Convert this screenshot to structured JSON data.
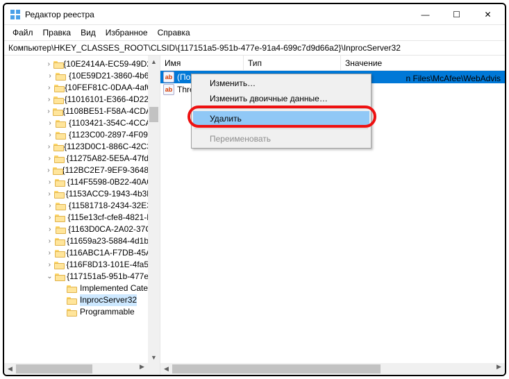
{
  "window": {
    "title": "Редактор реестра"
  },
  "win_controls": {
    "min": "—",
    "max": "☐",
    "close": "✕"
  },
  "menubar": [
    "Файл",
    "Правка",
    "Вид",
    "Избранное",
    "Справка"
  ],
  "address": "Компьютер\\HKEY_CLASSES_ROOT\\CLSID\\{117151a5-951b-477e-91a4-699c7d9d66a2}\\InprocServer32",
  "tree": {
    "indent1": 56,
    "indent2": 72,
    "indent3": 88,
    "items": [
      "{10E2414A-EC59-49D2…",
      "{10E59D21-3860-4b6…",
      "{10FEF81C-0DAA-4af0…",
      "{11016101-E366-4D22-…",
      "{1108BE51-F58A-4CDA…",
      "{1103421-354C-4CCA…",
      "{1123C00-2897-4F09-…",
      "{1123D0C1-886C-42C3…",
      "{11275A82-5E5A-47fd-…",
      "{112BC2E7-9EF9-3648-…",
      "{114F5598-0B22-40A0…",
      "{1153ACC9-1943-4b3b…",
      "{11581718-2434-32E3…",
      "{115e13cf-cfe8-4821-b…",
      "{1163D0CA-2A02-37C…",
      "{11659a23-5884-4d1b-…",
      "{116ABC1A-F7DB-45A…",
      "{116F8D13-101E-4fa5-…",
      "{117151a5-951b-477e-…"
    ],
    "children": [
      "Implemented Cate…",
      "InprocServer32",
      "Programmable"
    ]
  },
  "list": {
    "columns": [
      "Имя",
      "Тип",
      "Значение"
    ],
    "rows": [
      {
        "icon": "ab",
        "name": "(По у",
        "trail": "n Files\\McAfee\\WebAdvis"
      },
      {
        "icon": "ab",
        "name": "Threa",
        "trail": ""
      }
    ]
  },
  "contextmenu": {
    "items": [
      "Изменить…",
      "Изменить двоичные данные…",
      "Удалить",
      "Переименовать"
    ],
    "highlight_index": 2,
    "disabled_index": 3
  }
}
